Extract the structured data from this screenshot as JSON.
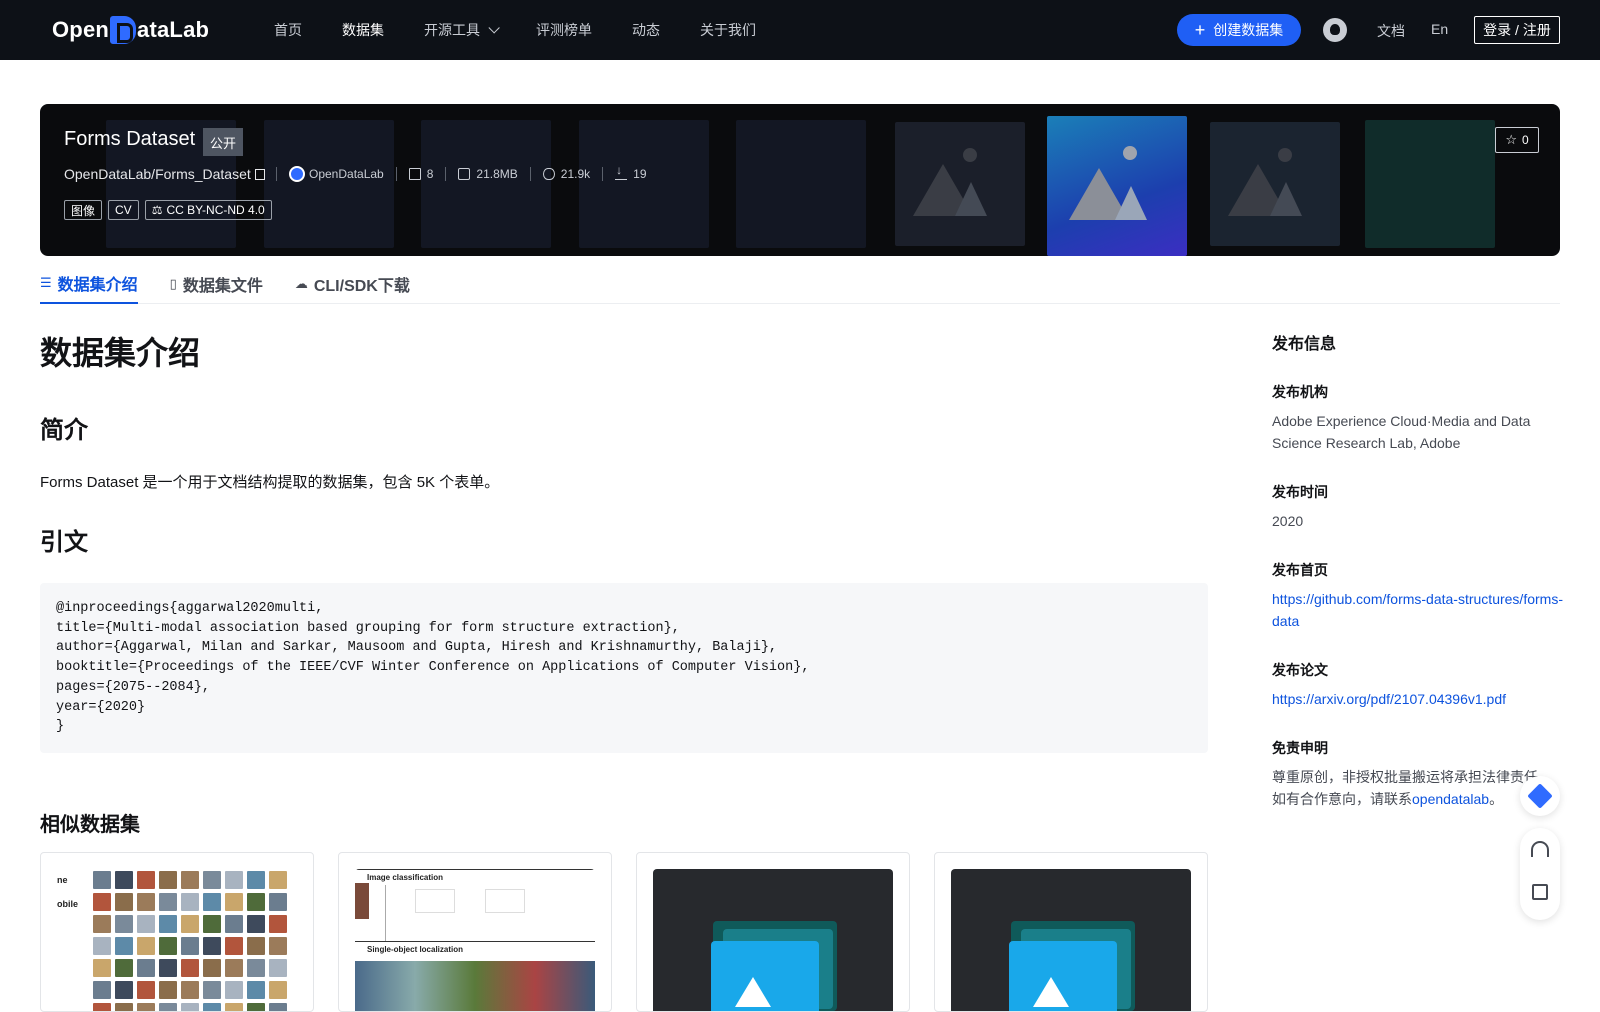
{
  "nav": {
    "logo": "OpenDataLab",
    "logo_left": "Open",
    "logo_right": "ataLab",
    "items": [
      {
        "label": "首页",
        "active": false
      },
      {
        "label": "数据集",
        "active": true
      },
      {
        "label": "开源工具",
        "active": false,
        "dropdown": true
      },
      {
        "label": "评测榜单",
        "active": false
      },
      {
        "label": "动态",
        "active": false
      },
      {
        "label": "关于我们",
        "active": false
      }
    ],
    "create_button": "创建数据集",
    "github_icon": "github-icon",
    "docs": "文档",
    "lang": "En",
    "login": "登录 / 注册"
  },
  "banner": {
    "title": "Forms Dataset",
    "visibility": "公开",
    "path": "OpenDataLab/Forms_Dataset",
    "org": "OpenDataLab",
    "file_count": "8",
    "size": "21.8MB",
    "views": "21.9k",
    "downloads": "19",
    "tags": [
      "图像",
      "CV",
      "CC BY-NC-ND 4.0"
    ],
    "stars": "0"
  },
  "tabs": [
    {
      "label": "数据集介绍",
      "icon": "database-icon",
      "active": true
    },
    {
      "label": "数据集文件",
      "icon": "file-icon",
      "active": false
    },
    {
      "label": "CLI/SDK下载",
      "icon": "cloud-download-icon",
      "active": false
    }
  ],
  "main": {
    "heading": "数据集介绍",
    "intro_heading": "简介",
    "intro_text": "Forms Dataset 是一个用于文档结构提取的数据集，包含 5K 个表单。",
    "citation_heading": "引文",
    "citation": "@inproceedings{aggarwal2020multi,\ntitle={Multi-modal association based grouping for form structure extraction},\nauthor={Aggarwal, Milan and Sarkar, Mausoom and Gupta, Hiresh and Krishnamurthy, Balaji},\nbooktitle={Proceedings of the IEEE/CVF Winter Conference on Applications of Computer Vision},\npages={2075--2084},\nyear={2020}\n}"
  },
  "sidebar": {
    "title": "发布信息",
    "org_label": "发布机构",
    "org_value": "Adobe Experience Cloud·Media and Data Science Research Lab, Adobe",
    "time_label": "发布时间",
    "time_value": "2020",
    "homepage_label": "发布首页",
    "homepage_value": "https://github.com/forms-data-structures/forms-data",
    "paper_label": "发布论文",
    "paper_value": "https://arxiv.org/pdf/2107.04396v1.pdf",
    "disclaimer_label": "免责申明",
    "disclaimer_text": "尊重原创，非授权批量搬运将承担法律责任。如有合作意向，请联系",
    "disclaimer_link": "opendatalab",
    "disclaimer_end": "。"
  },
  "similar": {
    "title": "相似数据集",
    "card_side_text": [
      "ne",
      "obile"
    ],
    "doc_card_labels": [
      "Image classification",
      "Single-object localization"
    ]
  }
}
